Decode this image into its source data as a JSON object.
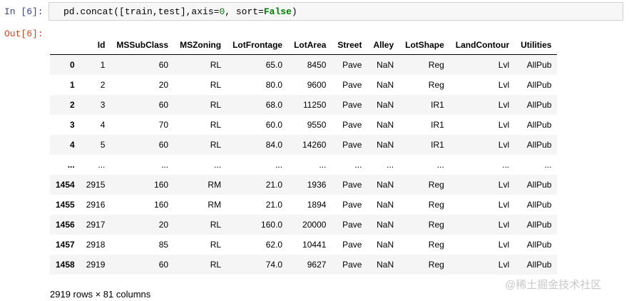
{
  "in_prompt": "In  [6]:",
  "out_prompt": "Out[6]:",
  "code": {
    "before_num": "pd.concat([train,test],axis=",
    "num": "0",
    "middle": ", sort=",
    "keyword": "False",
    "after": ")"
  },
  "columns": [
    "",
    "Id",
    "MSSubClass",
    "MSZoning",
    "LotFrontage",
    "LotArea",
    "Street",
    "Alley",
    "LotShape",
    "LandContour",
    "Utilities"
  ],
  "rows": [
    [
      "0",
      "1",
      "60",
      "RL",
      "65.0",
      "8450",
      "Pave",
      "NaN",
      "Reg",
      "Lvl",
      "AllPub"
    ],
    [
      "1",
      "2",
      "20",
      "RL",
      "80.0",
      "9600",
      "Pave",
      "NaN",
      "Reg",
      "Lvl",
      "AllPub"
    ],
    [
      "2",
      "3",
      "60",
      "RL",
      "68.0",
      "11250",
      "Pave",
      "NaN",
      "IR1",
      "Lvl",
      "AllPub"
    ],
    [
      "3",
      "4",
      "70",
      "RL",
      "60.0",
      "9550",
      "Pave",
      "NaN",
      "IR1",
      "Lvl",
      "AllPub"
    ],
    [
      "4",
      "5",
      "60",
      "RL",
      "84.0",
      "14260",
      "Pave",
      "NaN",
      "IR1",
      "Lvl",
      "AllPub"
    ],
    [
      "...",
      "...",
      "...",
      "...",
      "...",
      "...",
      "...",
      "...",
      "...",
      "...",
      "..."
    ],
    [
      "1454",
      "2915",
      "160",
      "RM",
      "21.0",
      "1936",
      "Pave",
      "NaN",
      "Reg",
      "Lvl",
      "AllPub"
    ],
    [
      "1455",
      "2916",
      "160",
      "RM",
      "21.0",
      "1894",
      "Pave",
      "NaN",
      "Reg",
      "Lvl",
      "AllPub"
    ],
    [
      "1456",
      "2917",
      "20",
      "RL",
      "160.0",
      "20000",
      "Pave",
      "NaN",
      "Reg",
      "Lvl",
      "AllPub"
    ],
    [
      "1457",
      "2918",
      "85",
      "RL",
      "62.0",
      "10441",
      "Pave",
      "NaN",
      "Reg",
      "Lvl",
      "AllPub"
    ],
    [
      "1458",
      "2919",
      "60",
      "RL",
      "74.0",
      "9627",
      "Pave",
      "NaN",
      "Reg",
      "Lvl",
      "AllPub"
    ]
  ],
  "footer": "2919 rows × 81 columns",
  "watermark": "@稀土掘金技术社区"
}
